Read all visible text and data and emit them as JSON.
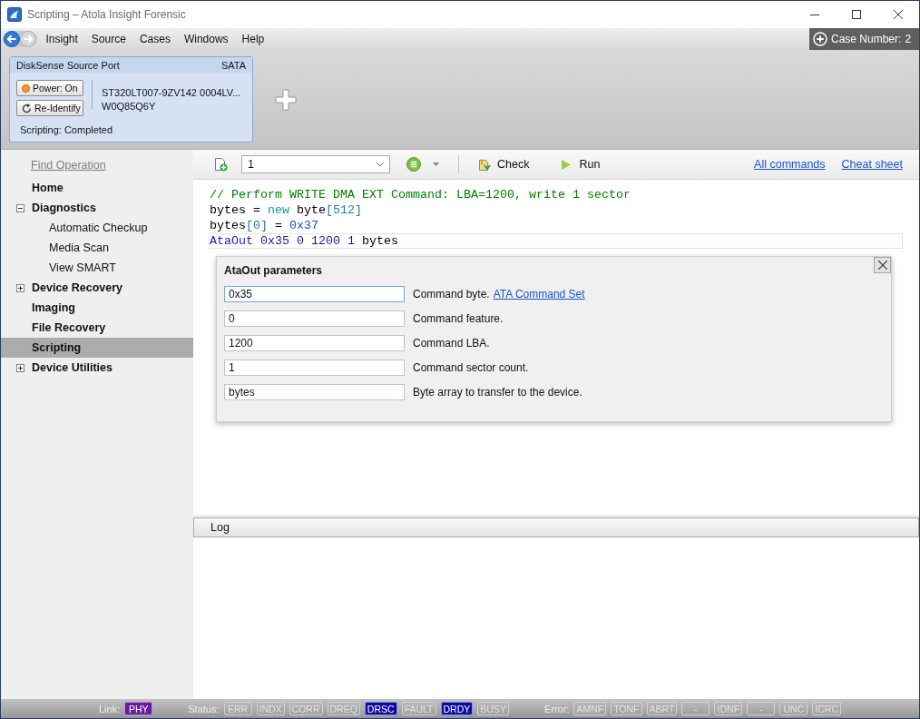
{
  "window": {
    "title": "Scripting – Atola Insight Forensic"
  },
  "menu": [
    "Insight",
    "Source",
    "Cases",
    "Windows",
    "Help"
  ],
  "case_number": {
    "label": "Case Number:",
    "value": "2"
  },
  "source_port": {
    "title": "DiskSense Source Port",
    "interface": "SATA",
    "buttons": [
      {
        "kind": "power",
        "label": "Power: On"
      },
      {
        "kind": "reidentify",
        "label": "Re-Identify"
      }
    ],
    "device": [
      "ST320LT007-9ZV142 0004LV...",
      "W0Q85Q6Y"
    ],
    "status": "Scripting: Completed"
  },
  "sidebar": {
    "find_operation": "Find Operation",
    "items": [
      {
        "label": "Home",
        "selected": false
      },
      {
        "label": "Diagnostics",
        "selected": false,
        "expanded": true,
        "children": [
          {
            "label": "Automatic Checkup",
            "selected": false
          },
          {
            "label": "Media Scan",
            "selected": false
          },
          {
            "label": "View SMART",
            "selected": false
          }
        ]
      },
      {
        "label": "Device Recovery",
        "selected": false,
        "expanded": false
      },
      {
        "label": "Imaging",
        "selected": false
      },
      {
        "label": "File Recovery",
        "selected": false
      },
      {
        "label": "Scripting",
        "selected": true
      },
      {
        "label": "Device Utilities",
        "selected": false,
        "expanded": false
      }
    ]
  },
  "toolbar": {
    "script": {
      "value": "1"
    },
    "actions": [
      {
        "kind": "check",
        "label": "Check"
      },
      {
        "kind": "run",
        "label": "Run"
      }
    ],
    "links": [
      "All commands",
      "Cheat sheet"
    ]
  },
  "editor": {
    "lines": [
      {
        "current": false,
        "tokens": [
          {
            "kind": "comment",
            "text": "// Perform WRITE DMA EXT Command: LBA=1200, write 1 sector"
          }
        ]
      },
      {
        "current": false,
        "tokens": [
          {
            "kind": "plain",
            "text": "bytes = "
          },
          {
            "kind": "keyword",
            "text": "new"
          },
          {
            "kind": "plain",
            "text": " byte"
          },
          {
            "kind": "index",
            "text": "[512]"
          }
        ]
      },
      {
        "current": false,
        "tokens": [
          {
            "kind": "plain",
            "text": "bytes"
          },
          {
            "kind": "index",
            "text": "[0]"
          },
          {
            "kind": "plain",
            "text": " = "
          },
          {
            "kind": "number",
            "text": "0x37"
          }
        ]
      },
      {
        "current": true,
        "tokens": [
          {
            "kind": "command",
            "text": "AtaOut"
          },
          {
            "kind": "argument",
            "text": " 0x35 0 1200 1 "
          },
          {
            "kind": "plain",
            "text": "bytes"
          }
        ]
      }
    ]
  },
  "parameters_popup": {
    "title": "AtaOut parameters",
    "params": [
      {
        "value": "0x35",
        "description": "Command byte.",
        "link": "ATA Command Set",
        "focused": true
      },
      {
        "value": "0",
        "description": "Command feature.",
        "focused": false
      },
      {
        "value": "1200",
        "description": "Command LBA.",
        "focused": false
      },
      {
        "value": "1",
        "description": "Command sector count.",
        "focused": false
      },
      {
        "value": "bytes",
        "description": "Byte array to transfer to the device.",
        "focused": false
      }
    ]
  },
  "log": {
    "title": "Log"
  },
  "status_bar": {
    "groups": [
      {
        "kind": "link",
        "label": "Link:",
        "flags": [
          {
            "text": "PHY",
            "on": true
          }
        ]
      },
      {
        "kind": "status",
        "label": "Status:",
        "flags": [
          {
            "text": "ERR",
            "on": false
          },
          {
            "text": "INDX",
            "on": false
          },
          {
            "text": "CORR",
            "on": false
          },
          {
            "text": "DREQ",
            "on": false
          },
          {
            "text": "DRSC",
            "on": true
          },
          {
            "text": "FAULT",
            "on": false
          },
          {
            "text": "DRDY",
            "on": true
          },
          {
            "text": "BUSY",
            "on": false
          }
        ]
      },
      {
        "kind": "error",
        "label": "Error:",
        "flags": [
          {
            "text": "AMNF",
            "on": false
          },
          {
            "text": "TONF",
            "on": false
          },
          {
            "text": "ABRT",
            "on": false
          },
          {
            "text": "-",
            "on": false
          },
          {
            "text": "IDNF",
            "on": false
          },
          {
            "text": "-",
            "on": false
          },
          {
            "text": "UNC",
            "on": false
          },
          {
            "text": "ICRC",
            "on": false
          }
        ]
      }
    ]
  }
}
